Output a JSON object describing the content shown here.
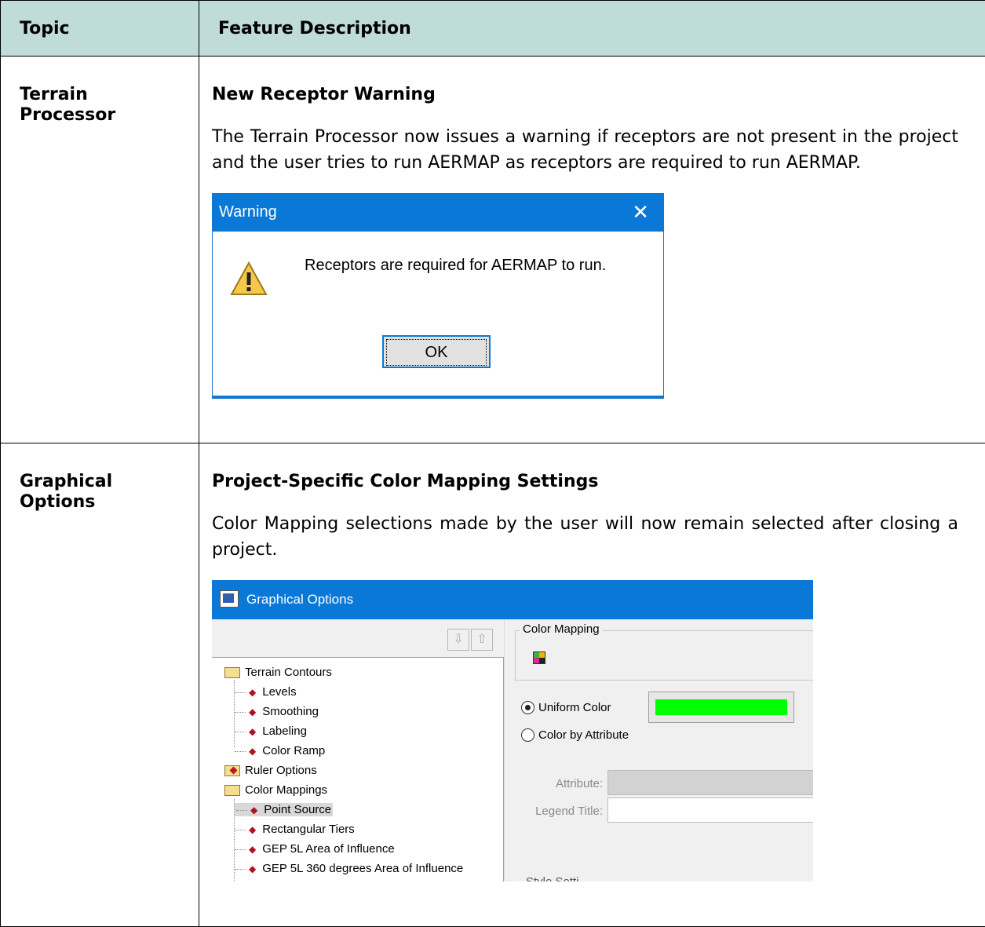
{
  "table": {
    "header": {
      "topic": "Topic",
      "feature": "Feature Description"
    },
    "rows": [
      {
        "topic": "Terrain Processor",
        "feature_title": "New Receptor Warning",
        "feature_desc": "The Terrain Processor now issues a warning if receptors are not present in the project and the user tries to run AERMAP as receptors are required to run AERMAP."
      },
      {
        "topic": "Graphical Options",
        "feature_title": "Project-Specific Color Mapping Settings",
        "feature_desc": "Color Mapping selections made by the user will now remain selected after closing a project."
      }
    ]
  },
  "warning_dialog": {
    "title": "Warning",
    "close_glyph": "✕",
    "icon": "warning-icon",
    "message": "Receptors are required for AERMAP to run.",
    "ok_label": "OK"
  },
  "graphical_dialog": {
    "title": "Graphical Options",
    "toolbar": {
      "import_glyph": "⇩",
      "export_glyph": "⇧"
    },
    "tree": {
      "terrain_contours": "Terrain Contours",
      "levels": "Levels",
      "smoothing": "Smoothing",
      "labeling": "Labeling",
      "color_ramp": "Color Ramp",
      "ruler_options": "Ruler Options",
      "color_mappings": "Color Mappings",
      "point_source": "Point Source",
      "rectangular_tiers": "Rectangular Tiers",
      "gep_area": "GEP 5L Area of Influence",
      "gep_360": "GEP 5L 360 degrees Area of Influence"
    },
    "color_mapping": {
      "group_label": "Color Mapping",
      "uniform_color": "Uniform Color",
      "color_by_attribute": "Color by Attribute",
      "uniform_swatch_color": "#00ff00",
      "attribute_label": "Attribute:",
      "legend_title_label": "Legend Title:",
      "style_setting_peek": "Style Setti"
    }
  }
}
